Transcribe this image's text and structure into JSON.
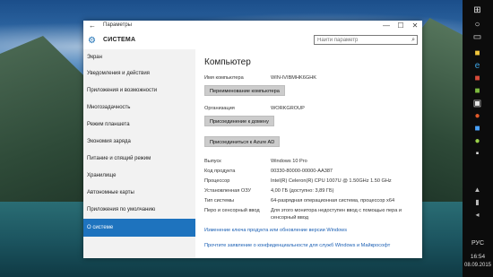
{
  "window": {
    "title": "Параметры",
    "heading": "СИСТЕМА",
    "controls": {
      "minimize": "—",
      "maximize": "☐",
      "close": "✕"
    }
  },
  "search": {
    "placeholder": "Найти параметр"
  },
  "sidebar": {
    "items": [
      {
        "label": "Экран",
        "active": false
      },
      {
        "label": "Уведомления и действия",
        "active": false
      },
      {
        "label": "Приложения и возможности",
        "active": false
      },
      {
        "label": "Многозадачность",
        "active": false
      },
      {
        "label": "Режим планшета",
        "active": false
      },
      {
        "label": "Экономия заряда",
        "active": false
      },
      {
        "label": "Питание и спящий режим",
        "active": false
      },
      {
        "label": "Хранилище",
        "active": false
      },
      {
        "label": "Автономные карты",
        "active": false
      },
      {
        "label": "Приложения по умолчанию",
        "active": false
      },
      {
        "label": "О системе",
        "active": true
      }
    ]
  },
  "content": {
    "title": "Компьютер",
    "computer_name_label": "Имя компьютера",
    "computer_name_value": "WIN-IVIBMHK6GHK",
    "rename_button": "Переименование компьютера",
    "org_label": "Организация",
    "org_value": "WORKGROUP",
    "join_domain_button": "Присоединение к домену",
    "join_azure_button": "Присоединиться к Azure AD",
    "specs": [
      {
        "label": "Выпуск",
        "value": "Windows 10 Pro"
      },
      {
        "label": "Код продукта",
        "value": "00330-80000-00000-AA387"
      },
      {
        "label": "Процессор",
        "value": "Intel(R) Celeron(R) CPU 1007U @ 1.50GHz   1.50 GHz"
      },
      {
        "label": "Установленная ОЗУ",
        "value": "4,00 ГБ (доступно: 3,89 ГБ)"
      },
      {
        "label": "Тип системы",
        "value": "64-разрядная операционная система, процессор x64"
      },
      {
        "label": "Перо и сенсорный ввод",
        "value": "Для этого монитора недоступен ввод с помощью пера и",
        "value2": "сенсорный ввод"
      }
    ],
    "links": [
      "Изменение ключа продукта или обновление версии Windows",
      "Прочтите заявление о конфиденциальности для служб Windows и Майкрософт"
    ]
  },
  "taskbar": {
    "language": "РУС",
    "time": "16:54",
    "date": "08.09.2015"
  },
  "colors": {
    "accent": "#1e73be",
    "link": "#1a5fb4",
    "sidebar_bg": "#f2f2f2"
  },
  "icons": [
    "back-arrow-icon",
    "gear-icon",
    "search-icon",
    "start-icon",
    "cortana-icon",
    "task-view-icon"
  ]
}
